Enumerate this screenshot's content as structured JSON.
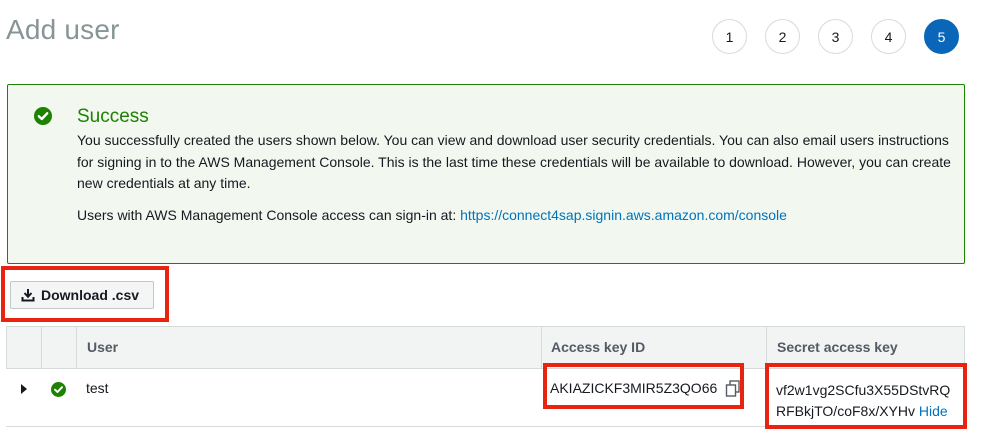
{
  "page": {
    "title": "Add user"
  },
  "steps": [
    "1",
    "2",
    "3",
    "4",
    "5"
  ],
  "active_step": "5",
  "success": {
    "title": "Success",
    "message": "You successfully created the users shown below. You can view and download user security credentials. You can also email users instructions for signing in to the AWS Management Console. This is the last time these credentials will be available to download. However, you can create new credentials at any time.",
    "signin_prefix": "Users with AWS Management Console access can sign-in at: ",
    "signin_url": "https://connect4sap.signin.aws.amazon.com/console"
  },
  "toolbar": {
    "download_label": "Download .csv"
  },
  "table": {
    "headers": {
      "user": "User",
      "access_key_id": "Access key ID",
      "secret_access_key": "Secret access key"
    },
    "rows": [
      {
        "user": "test",
        "access_key_id": "AKIAZICKF3MIR5Z3QO66",
        "secret_line1": "vf2w1vg2SCfu3X55DStvRQ",
        "secret_line2": "RFBkjTO/coF8x/XYHv",
        "hide_label": "Hide"
      }
    ]
  },
  "colors": {
    "accent": "#0a66b8",
    "success": "#1d8102",
    "link": "#0073bb",
    "highlight": "#e8230f"
  },
  "icons": [
    "success-check-icon",
    "download-icon",
    "expand-caret-icon",
    "row-success-icon",
    "copy-icon"
  ]
}
